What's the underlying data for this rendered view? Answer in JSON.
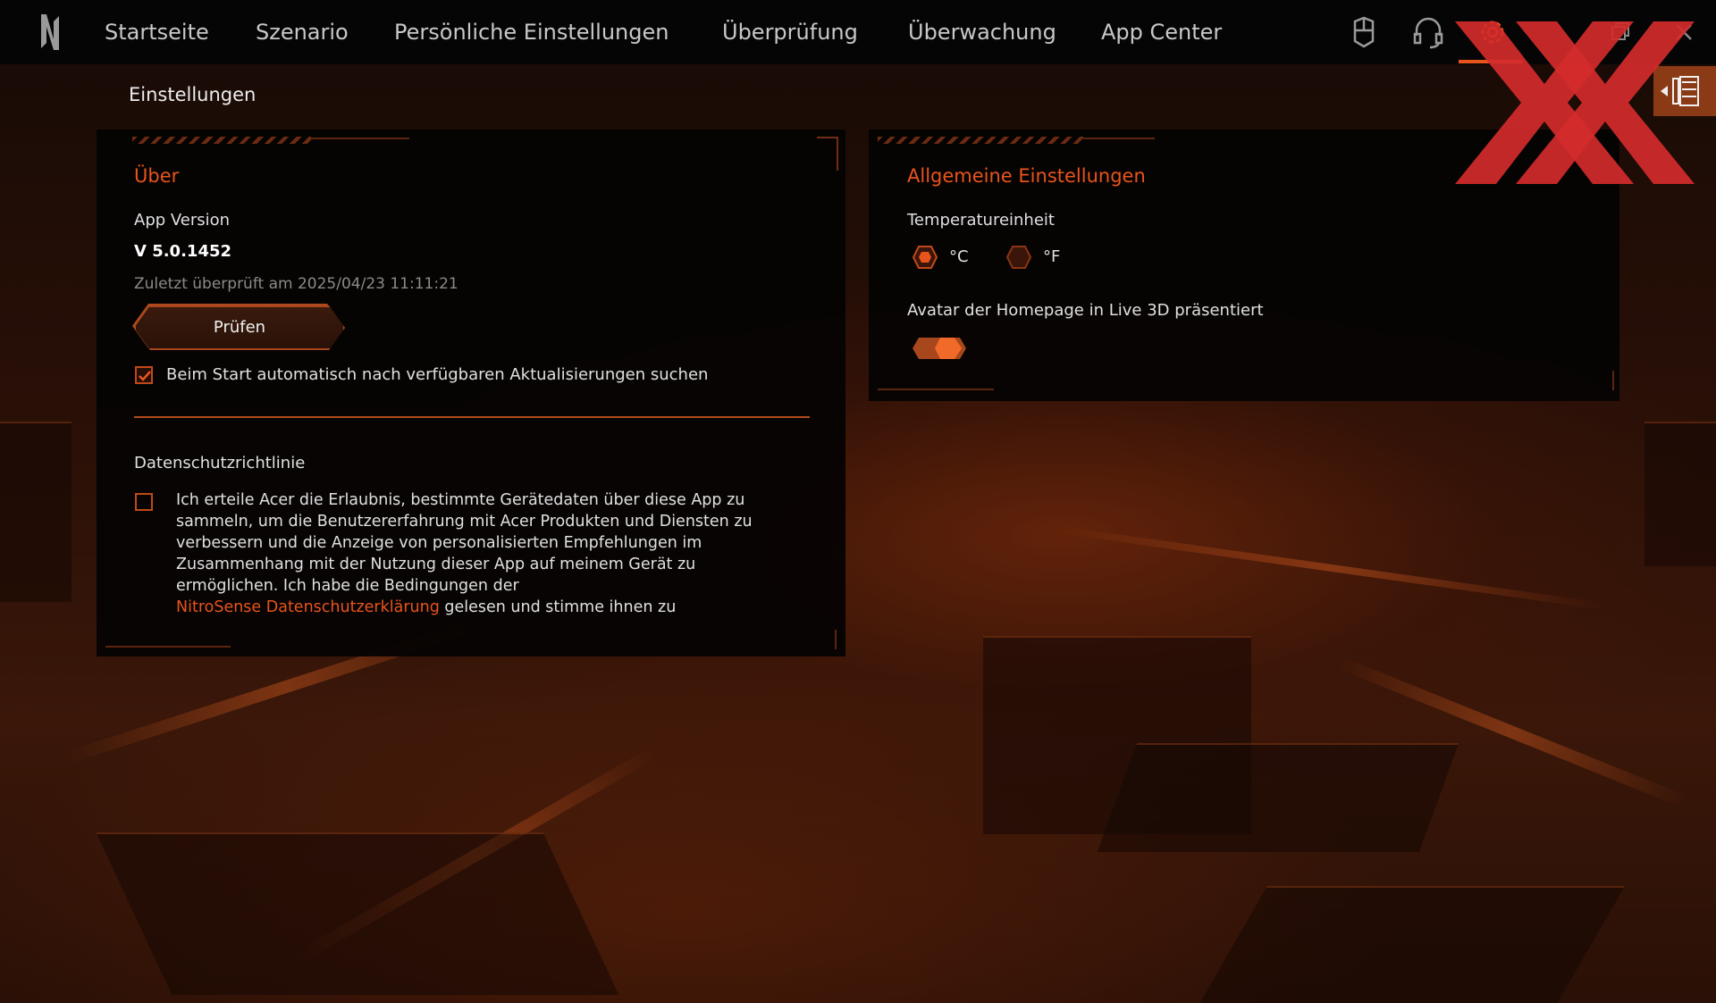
{
  "nav": {
    "items": [
      {
        "label": "Startseite"
      },
      {
        "label": "Szenario"
      },
      {
        "label": "Persönliche Einstellungen"
      },
      {
        "label": "Überprüfung"
      },
      {
        "label": "Überwachung"
      },
      {
        "label": "App Center"
      }
    ],
    "icons": [
      "mouse-icon",
      "headset-icon",
      "gear-icon",
      "restore-window-icon",
      "close-icon"
    ],
    "active_icon": "gear-icon"
  },
  "page": {
    "title": "Einstellungen"
  },
  "about": {
    "title": "Über",
    "version_label": "App Version",
    "version_value": "V 5.0.1452",
    "last_checked": "Zuletzt überprüft am 2025/04/23 11:11:21",
    "check_button": "Prüfen",
    "auto_update_label": "Beim Start automatisch nach verfügbaren Aktualisierungen suchen",
    "auto_update_checked": true,
    "privacy_title": "Datenschutzrichtlinie",
    "consent_checked": false,
    "consent_text": "Ich erteile Acer die Erlaubnis, bestimmte Gerätedaten über diese App zu sammeln, um die Benutzererfahrung mit Acer Produkten und Diensten zu verbessern und die Anzeige von personalisierten Empfehlungen im Zusammenhang mit der Nutzung dieser App auf meinem Gerät zu ermöglichen. Ich habe die Bedingungen der",
    "consent_link": "NitroSense Datenschutzerklärung",
    "consent_tail": "gelesen und stimme ihnen zu"
  },
  "general": {
    "title": "Allgemeine Einstellungen",
    "temperature_label": "Temperatureinheit",
    "unit_celsius": "°C",
    "unit_fahrenheit": "°F",
    "selected_unit": "°C",
    "avatar_label": "Avatar der Homepage in Live 3D präsentiert",
    "avatar_toggle_on": true
  },
  "colors": {
    "accent": "#e8541c",
    "panel_bg": "#050303",
    "topbar_bg": "#050505",
    "watermark": "#d42b2b"
  }
}
